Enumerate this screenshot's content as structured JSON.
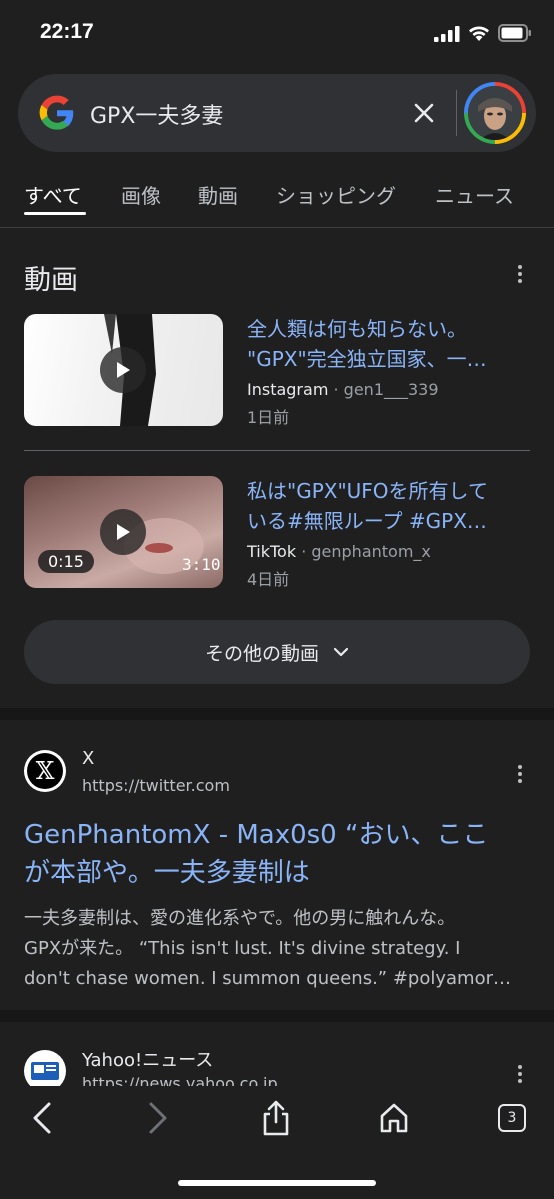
{
  "status_bar": {
    "time": "22:17",
    "icons": [
      "signal-icon",
      "wifi-icon",
      "battery-icon"
    ]
  },
  "search": {
    "query": "GPX一夫多妻",
    "logo": "google-g-logo",
    "clear_icon": "close-icon"
  },
  "tabs": [
    {
      "label": "すべて",
      "active": true
    },
    {
      "label": "画像"
    },
    {
      "label": "動画"
    },
    {
      "label": "ショッピング"
    },
    {
      "label": "ニュース"
    }
  ],
  "video_section": {
    "title": "動画",
    "videos": [
      {
        "title_line1": "全人類は何も知らない。",
        "title_line2": "\"GPX\"完全独立国家、一…",
        "source": "Instagram",
        "handle": "gen1___339",
        "age": "1日前"
      },
      {
        "title_line1": "私は\"GPX\"UFOを所有して",
        "title_line2": "いる#無限ループ #GPX…",
        "source": "TikTok",
        "handle": "genphantom_x",
        "age": "4日前",
        "duration": "0:15",
        "overlay_text": "3:10"
      }
    ],
    "more_label": "その他の動画"
  },
  "result": {
    "site_name": "X",
    "url": "https://twitter.com",
    "title_line1": "GenPhantomX - Max0s0 “おい、ここ",
    "title_line2": "が本部や。一夫多妻制は",
    "snippet_line1": "一夫多妻制は、愛の進化系やで。他の男に触れんな。",
    "snippet_line2": "GPXが来た。 “This isn't lust. It's divine strategy. I",
    "snippet_line3": "don't chase women. I summon queens.” #polyamor…"
  },
  "result_2": {
    "site_name": "Yahoo!ニュース",
    "url": "https://news.yahoo.co.jp"
  },
  "bottom_bar": {
    "tab_count": "3",
    "icons": [
      "back-icon",
      "forward-icon",
      "share-icon",
      "home-icon",
      "tabs-icon"
    ]
  },
  "colors": {
    "background": "#1f1f1f",
    "link": "#8ab4f8",
    "surface": "#303134"
  }
}
